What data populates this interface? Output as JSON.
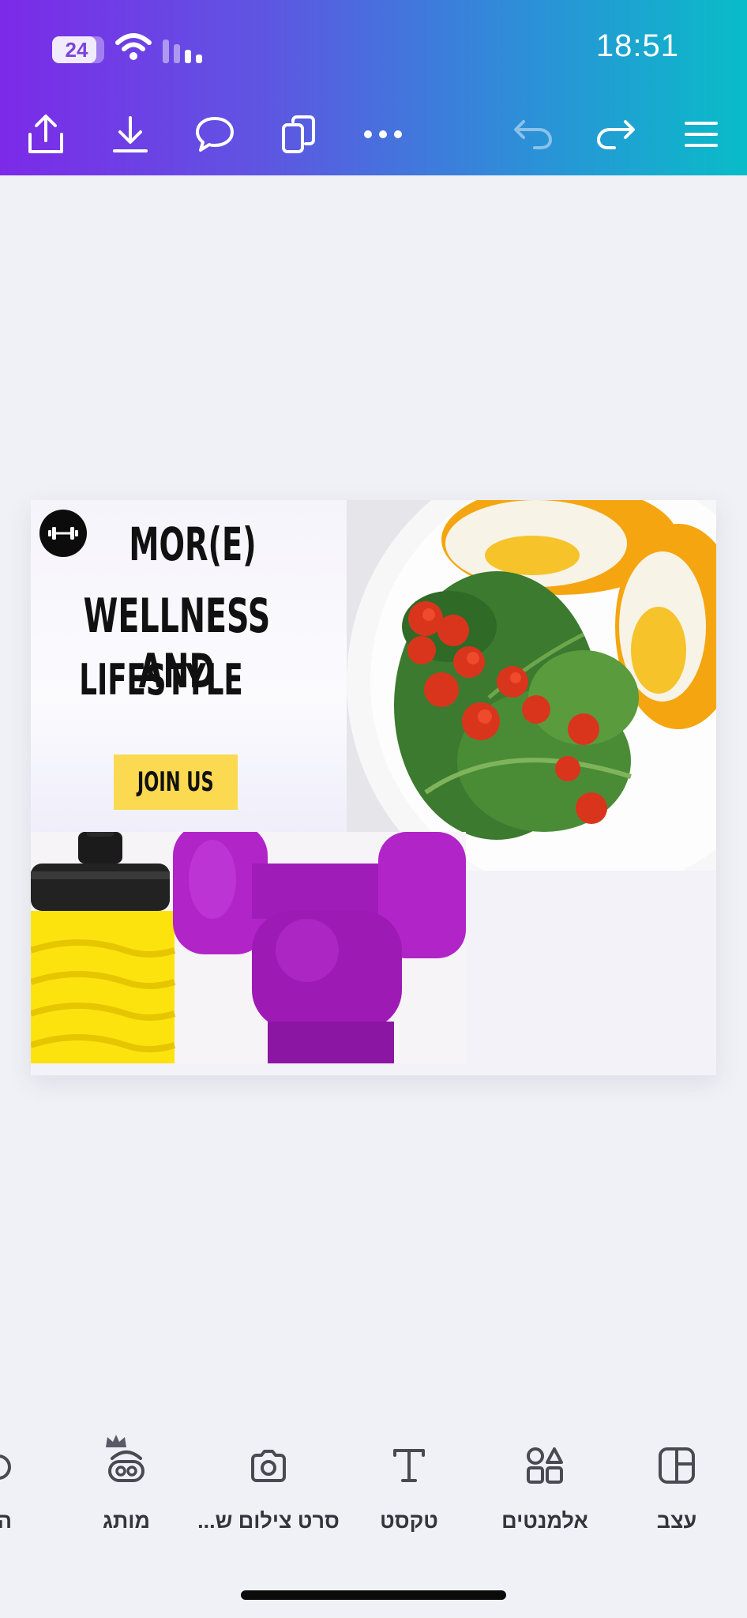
{
  "status_bar": {
    "battery": "24",
    "time": "18:51"
  },
  "toolbar": {
    "share_icon": "share-icon",
    "download_icon": "download-icon",
    "comment_icon": "comment-icon",
    "duplicate_icon": "duplicate-icon",
    "more_icon": "more-icon",
    "undo_icon": "undo-icon",
    "redo_icon": "redo-icon",
    "menu_icon": "menu-icon"
  },
  "design": {
    "headline_line1": "MOR(E)",
    "headline_line2": "WELLNESS AND",
    "headline_line3": "LIFESTYLE",
    "cta_label": "JOIN US",
    "accent_yellow": "#fbd951"
  },
  "bottom_tools": [
    {
      "label": "עצב",
      "icon": "design-icon"
    },
    {
      "label": "אלמנטים",
      "icon": "elements-icon"
    },
    {
      "label": "טקסט",
      "icon": "text-icon"
    },
    {
      "label": "סרט צילום ש...",
      "icon": "camera-icon"
    },
    {
      "label": "מותג",
      "icon": "brand-icon"
    },
    {
      "label": "הע",
      "icon": "upload-icon"
    }
  ],
  "colors": {
    "header_gradient_start": "#7c2ae8",
    "header_gradient_end": "#09bcc8",
    "canvas_bg": "#f0f1f6"
  }
}
